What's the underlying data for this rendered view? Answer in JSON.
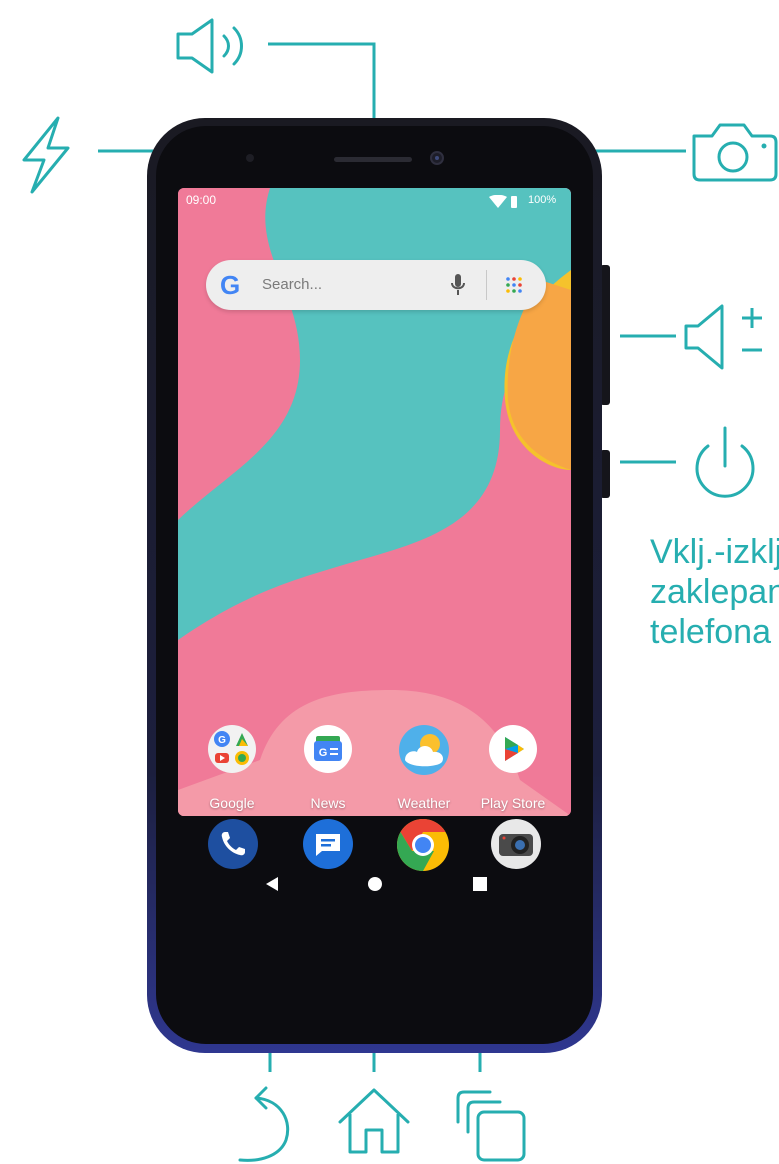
{
  "colors": {
    "accent": "#26aeb0",
    "phone_body": "#0e0e12",
    "phone_edge": "#2a2f6a"
  },
  "status_bar": {
    "time": "09:00",
    "battery": "100%",
    "icons": [
      "wifi-icon",
      "battery-icon"
    ]
  },
  "search_bar": {
    "placeholder": "Search...",
    "icons": [
      "google-g-icon",
      "mic-icon",
      "app-grid-icon"
    ]
  },
  "home_apps": [
    {
      "label": "Google",
      "icon": "google-folder-icon"
    },
    {
      "label": "News",
      "icon": "news-icon"
    },
    {
      "label": "Weather",
      "icon": "weather-icon"
    },
    {
      "label": "Play Store",
      "icon": "play-store-icon"
    }
  ],
  "dock_apps": [
    {
      "icon": "phone-icon"
    },
    {
      "icon": "messages-icon"
    },
    {
      "icon": "chrome-icon"
    },
    {
      "icon": "camera-app-icon"
    }
  ],
  "nav_buttons": [
    "back-icon",
    "home-dot-icon",
    "recents-square-icon"
  ],
  "callouts": {
    "top": [
      "speaker-icon",
      "flash-icon",
      "front-camera-icon"
    ],
    "side": [
      "volume-icon",
      "power-icon"
    ],
    "bottom": [
      "back-arrow-icon",
      "home-icon",
      "recent-apps-icon"
    ]
  },
  "power_caption": "Vklj.-izklj.\nzaklepanje\ntelefona"
}
